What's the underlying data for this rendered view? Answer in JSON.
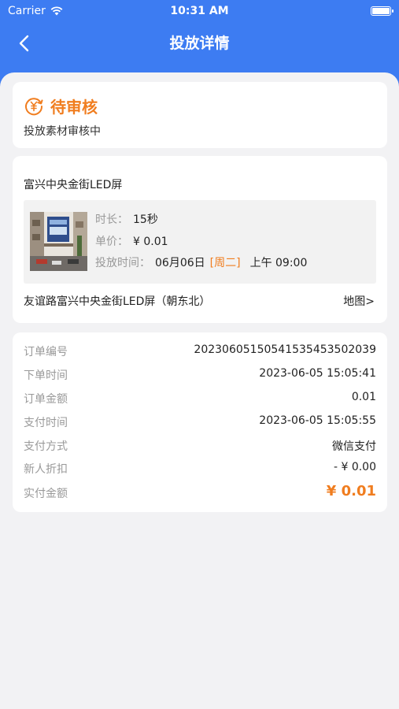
{
  "status_bar": {
    "carrier": "Carrier",
    "time": "10:31 AM"
  },
  "nav": {
    "title": "投放详情"
  },
  "status": {
    "title": "待审核",
    "subtitle": "投放素材审核中",
    "color": "#f07d1f"
  },
  "screen": {
    "name": "富兴中央金街LED屏",
    "duration_label": "时长：",
    "duration": "15秒",
    "price_label": "单价：",
    "price": "¥ 0.01",
    "time_label": "投放时间：",
    "date": "06月06日",
    "weekday": "[周二]",
    "time": "上午 09:00",
    "address": "友谊路富兴中央金街LED屏（朝东北）",
    "map_label": "地图>"
  },
  "order": {
    "rows": [
      {
        "label": "订单编号",
        "value": "2023060515054153545350​2039"
      },
      {
        "label": "下单时间",
        "value": "2023-06-05 15:05:41"
      },
      {
        "label": "订单金额",
        "value": "0.01"
      },
      {
        "label": "支付时间",
        "value": "2023-06-05 15:05:55"
      },
      {
        "label": "支付方式",
        "value": "微信支付"
      },
      {
        "label": "新人折扣",
        "value": "- ¥ 0.00"
      },
      {
        "label": "实付金额",
        "value": "¥ 0.01"
      }
    ]
  },
  "colors": {
    "primary": "#3d7cf2",
    "accent": "#f07d1f",
    "background": "#f2f2f4"
  }
}
